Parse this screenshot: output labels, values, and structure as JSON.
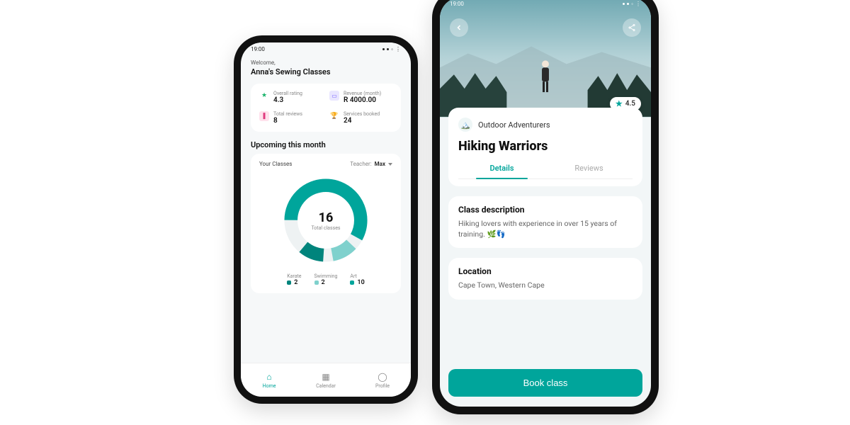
{
  "status_time": "19:00",
  "left": {
    "welcome_label": "Welcome,",
    "welcome_name": "Anna's Sewing Classes",
    "stats": {
      "rating_label": "Overall rating",
      "rating_value": "4.3",
      "revenue_label": "Revenue (month)",
      "revenue_value": "R 4000.00",
      "reviews_label": "Total reviews",
      "reviews_value": "8",
      "booked_label": "Services booked",
      "booked_value": "24"
    },
    "upcoming_title": "Upcoming this month",
    "class_card": {
      "title": "Your Classes",
      "teacher_label": "Teacher:",
      "teacher_value": "Max",
      "total_value": "16",
      "total_label": "Total classes",
      "legend": [
        {
          "label": "Karate",
          "value": "2",
          "color": "#00847c"
        },
        {
          "label": "Swimming",
          "value": "2",
          "color": "#7fd1cd"
        },
        {
          "label": "Art",
          "value": "10",
          "color": "#00a59b"
        }
      ]
    },
    "nav": {
      "home": "Home",
      "calendar": "Calendar",
      "profile": "Profile"
    }
  },
  "right": {
    "rating_chip": "4.5",
    "org_name": "Outdoor Adventurers",
    "class_title": "Hiking Warriors",
    "tabs": {
      "details": "Details",
      "reviews": "Reviews"
    },
    "desc_heading": "Class description",
    "desc_text": "Hiking lovers with experience in over 15 years of training. 🌿👣",
    "loc_heading": "Location",
    "loc_text": "Cape Town, Western Cape",
    "cta": "Book class"
  },
  "chart_data": {
    "type": "pie",
    "title": "Your Classes",
    "total": 16,
    "series": [
      {
        "name": "Karate",
        "value": 2,
        "color": "#00847c"
      },
      {
        "name": "Swimming",
        "value": 2,
        "color": "#7fd1cd"
      },
      {
        "name": "Art",
        "value": 10,
        "color": "#00a59b"
      }
    ]
  }
}
